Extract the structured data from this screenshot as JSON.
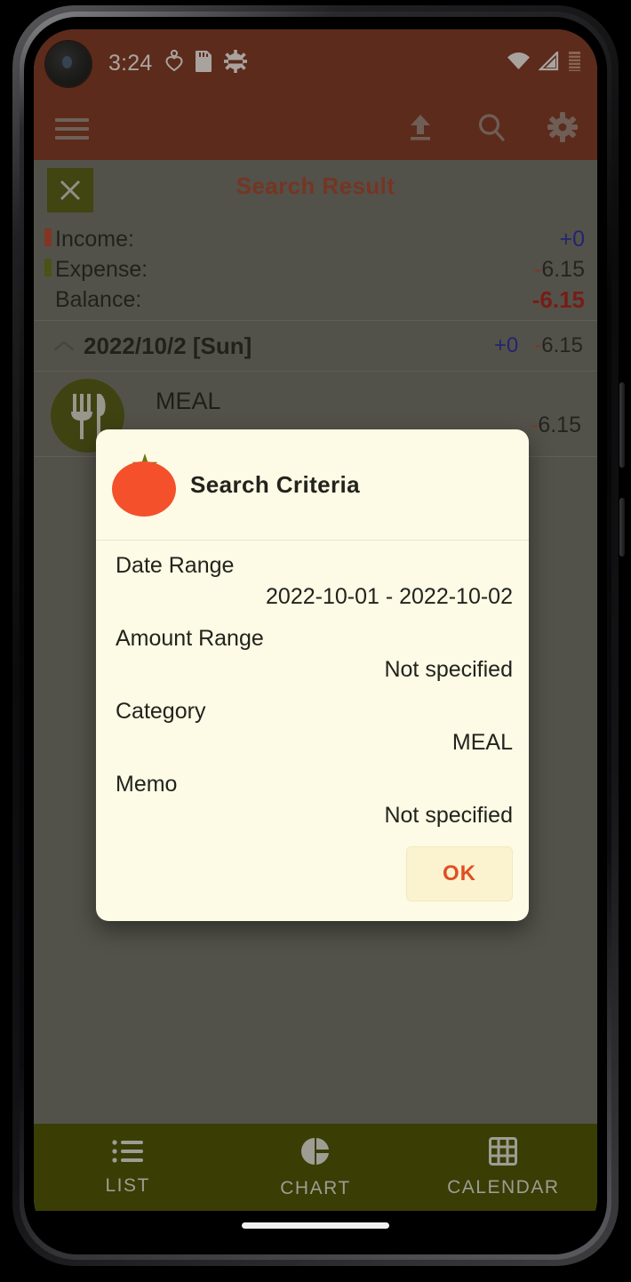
{
  "status_bar": {
    "time": "3:24",
    "left_icons": [
      "heart-pulse-icon",
      "sd-card-icon",
      "gear-icon"
    ],
    "right_icons": [
      "wifi-icon",
      "cellular-signal-icon",
      "battery-icon"
    ],
    "background": "#7a2a18"
  },
  "app_bar": {
    "menu_icon": "hamburger-menu-icon",
    "actions": [
      "upload-icon",
      "search-icon",
      "settings-gear-icon"
    ],
    "background": "#7a2a18"
  },
  "result": {
    "close_label": "✕",
    "title": "Search Result",
    "title_color": "#a33a22",
    "summary": [
      {
        "label": "Income:",
        "value": "+0",
        "marker_color": "#b53c22",
        "kind": "income"
      },
      {
        "label": "Expense:",
        "sign": "-",
        "value": "6.15",
        "marker_color": "#5c6a0d",
        "kind": "expense"
      },
      {
        "label": "Balance:",
        "sign": "-",
        "value": "6.15",
        "kind": "balance",
        "value_color": "#a5140f"
      }
    ]
  },
  "date_group": {
    "chevron": "chevron-up-icon",
    "date": "2022/10/2 [Sun]",
    "income": "+0",
    "expense_sign": "-",
    "expense": "6.15"
  },
  "entry": {
    "icon": "meal-cutlery-icon",
    "category": "MEAL",
    "amount_sign": "-",
    "amount": "6.15"
  },
  "dialog": {
    "icon": "tomato-icon",
    "title": "Search Criteria",
    "background": "#fdfae6",
    "rows": [
      {
        "label": "Date Range",
        "value": "2022-10-01 - 2022-10-02"
      },
      {
        "label": "Amount Range",
        "value": "Not specified"
      },
      {
        "label": "Category",
        "value": "MEAL"
      },
      {
        "label": "Memo",
        "value": "Not specified"
      }
    ],
    "ok_label": "OK",
    "ok_color": "#e04e22"
  },
  "bottom_nav": {
    "background": "#3a3d04",
    "items": [
      {
        "label": "LIST",
        "icon": "list-icon"
      },
      {
        "label": "CHART",
        "icon": "pie-chart-icon"
      },
      {
        "label": "CALENDAR",
        "icon": "calendar-grid-icon"
      }
    ]
  }
}
